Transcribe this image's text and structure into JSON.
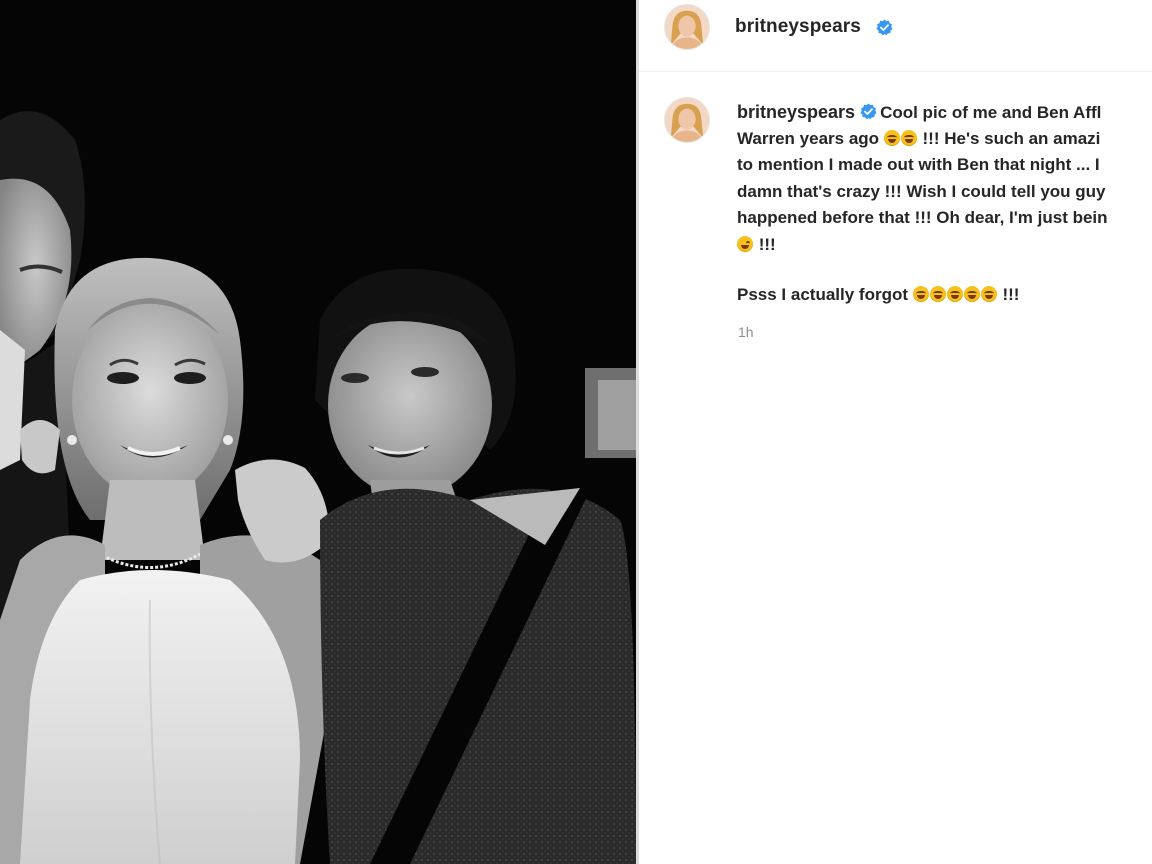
{
  "post": {
    "username": "britneyspears",
    "verified": true,
    "avatar_icon": "profile-avatar",
    "verified_icon": "verified-badge-icon",
    "verified_color": "#3897f0",
    "photo_description_icon": "black-and-white-photo"
  },
  "caption": {
    "username": "britneyspears",
    "line1_text": "Cool pic of me and Ben Affl",
    "line2_start": "Warren years ago",
    "line2_emojis": 2,
    "line2_end": "!!! He's such an amazi",
    "line3": "to mention I made out with Ben that night ... I",
    "line4": "damn that's crazy !!! Wish I could tell you guy",
    "line5": "happened before that !!! Oh dear, I'm just bein",
    "line6_emojis": 1,
    "line6_end": "!!!",
    "psss_start": "Psss I actually forgot",
    "psss_emojis": 5,
    "psss_end": "!!!",
    "timestamp": "1h"
  },
  "colors": {
    "text": "#262626",
    "muted": "#8e8e8e",
    "emoji": "#f7c01e",
    "photo_background": "#050505"
  }
}
